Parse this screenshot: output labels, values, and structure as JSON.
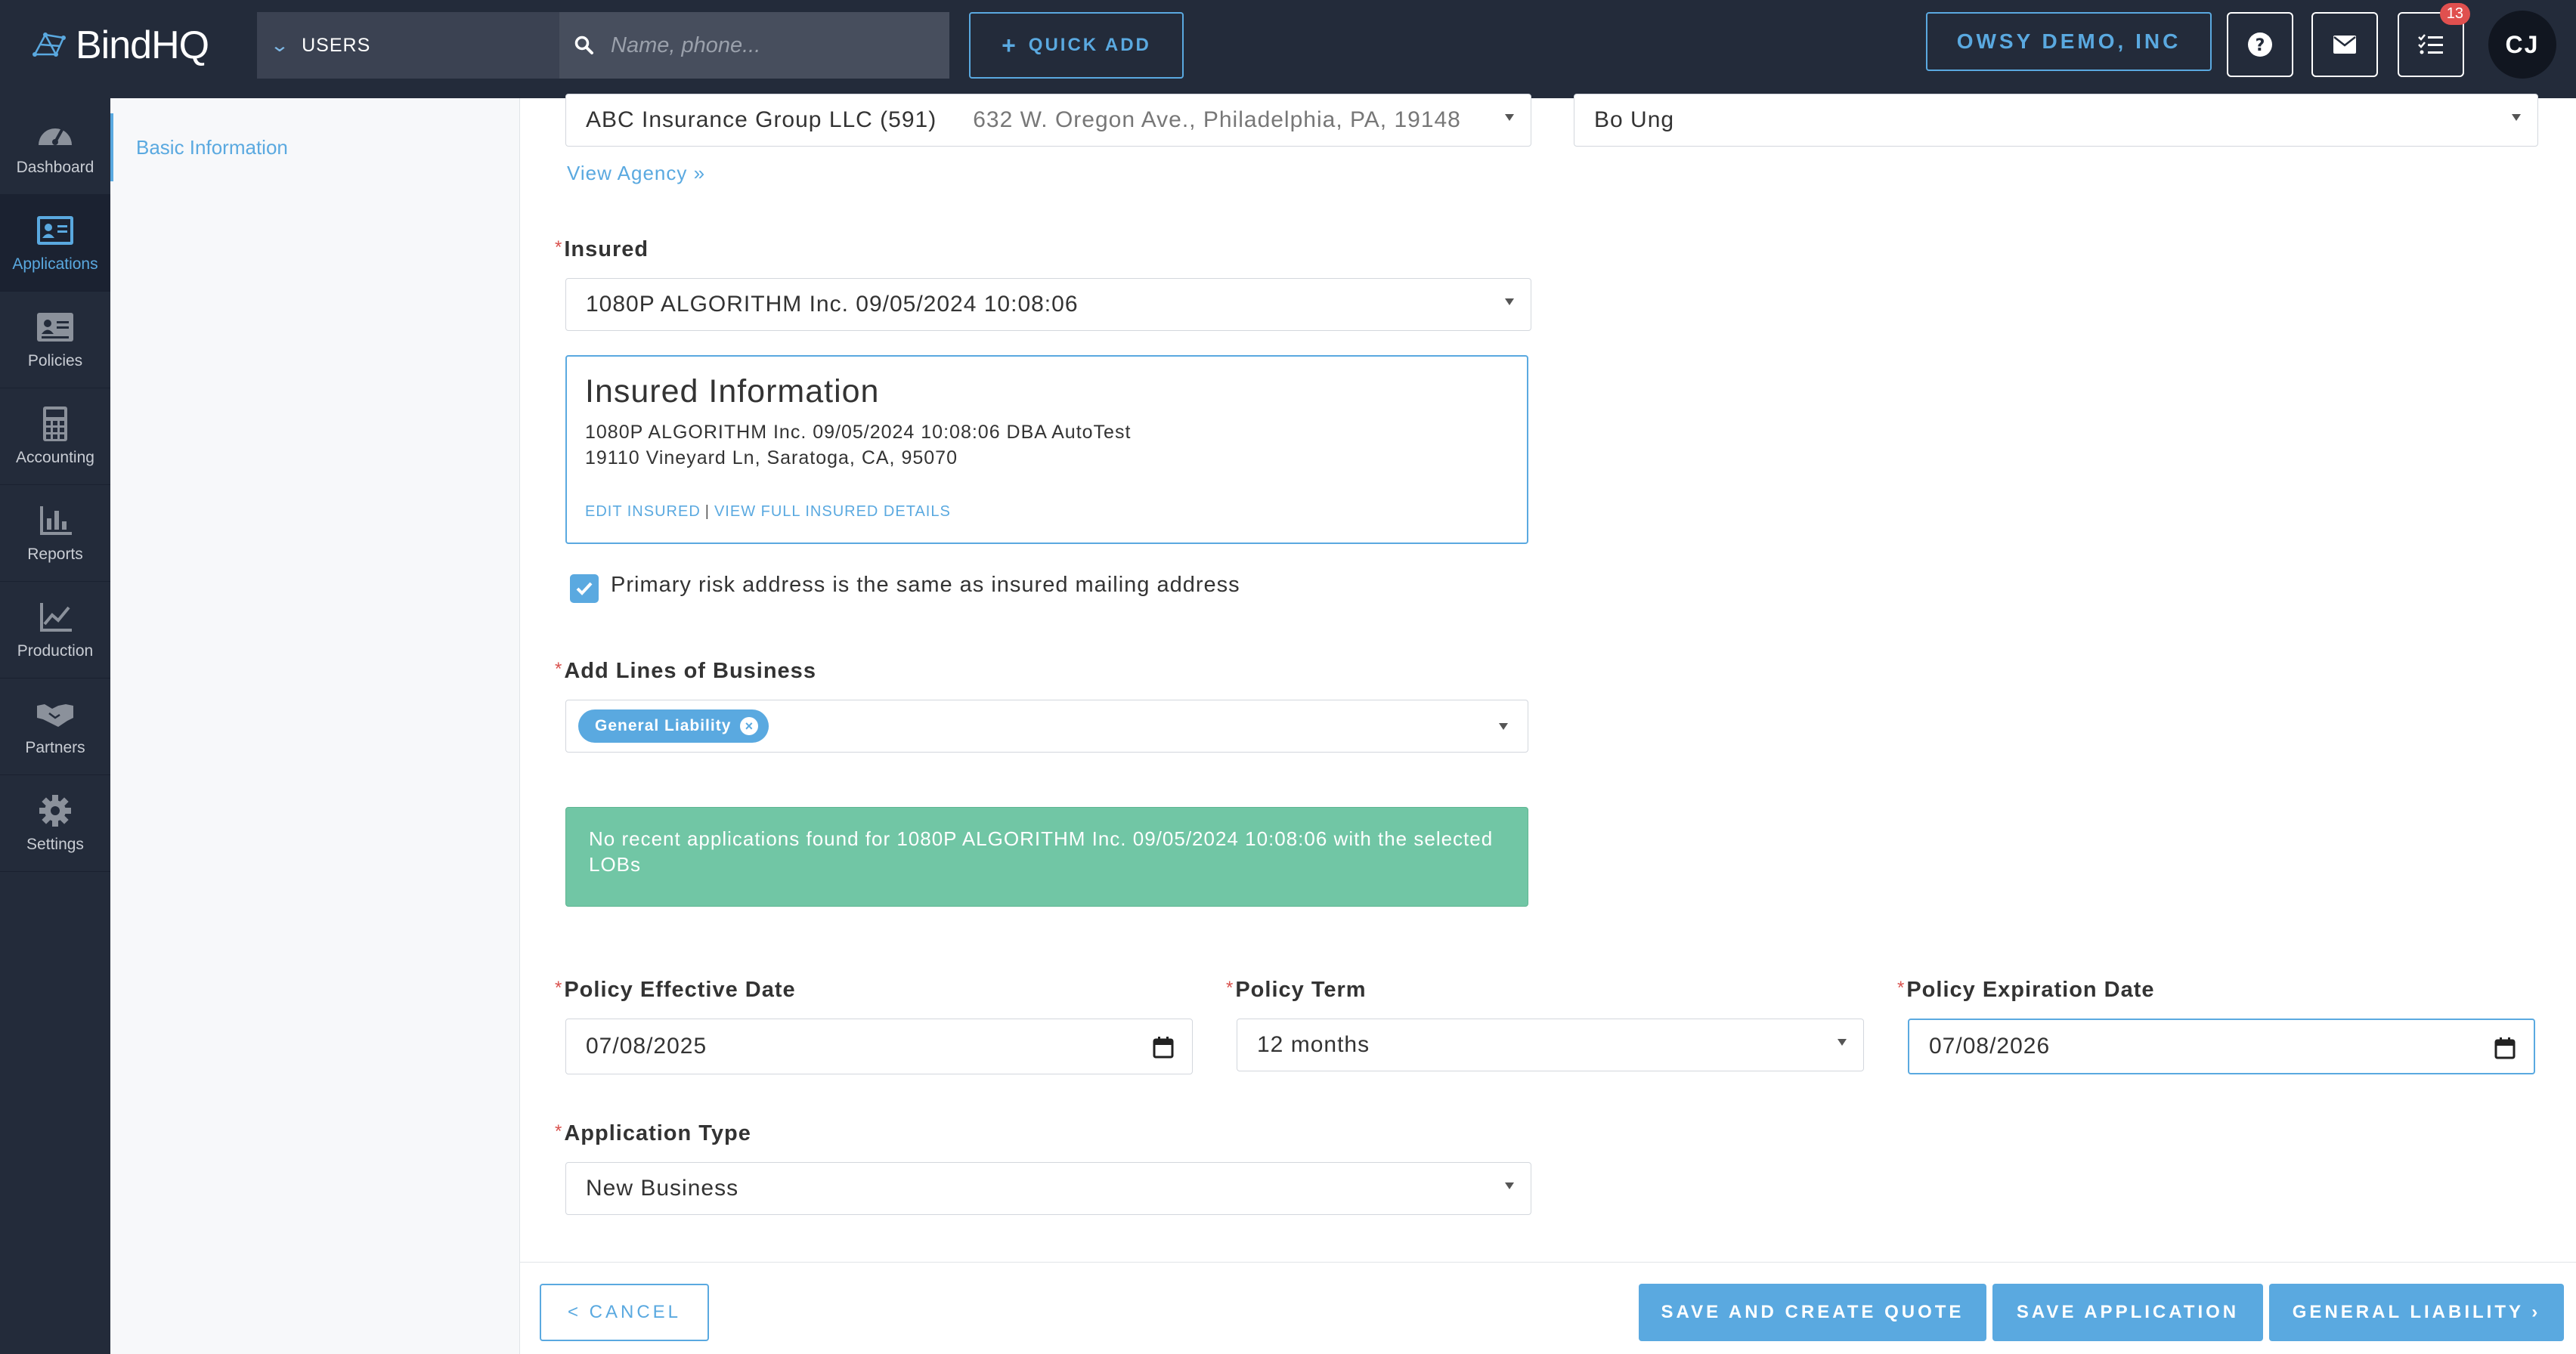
{
  "header": {
    "logo_text": "BindHQ",
    "search_scope": "USERS",
    "search_placeholder": "Name, phone...",
    "quick_add_label": "QUICK ADD",
    "org_name": "OWSY DEMO, INC",
    "tasks_badge": "13",
    "avatar_initials": "CJ"
  },
  "sidebar": {
    "items": [
      {
        "label": "Dashboard",
        "icon": "gauge-icon"
      },
      {
        "label": "Applications",
        "icon": "id-card-icon"
      },
      {
        "label": "Policies",
        "icon": "policy-card-icon"
      },
      {
        "label": "Accounting",
        "icon": "calculator-icon"
      },
      {
        "label": "Reports",
        "icon": "bar-chart-icon"
      },
      {
        "label": "Production",
        "icon": "line-chart-icon"
      },
      {
        "label": "Partners",
        "icon": "handshake-icon"
      },
      {
        "label": "Settings",
        "icon": "gear-icon"
      }
    ],
    "active": "Applications"
  },
  "subnav": {
    "items": [
      "Basic Information"
    ]
  },
  "form": {
    "agency": {
      "value": "ABC Insurance Group LLC (591)",
      "address": "632 W. Oregon Ave., Philadelphia, PA, 19148",
      "view_link": "View Agency »"
    },
    "agent": {
      "value": "Bo Ung"
    },
    "insured": {
      "label": "Insured",
      "value": "1080P ALGORITHM Inc. 09/05/2024 10:08:06"
    },
    "insured_info": {
      "title": "Insured Information",
      "name_line": "1080P ALGORITHM Inc. 09/05/2024 10:08:06 DBA AutoTest",
      "address_line": "19110 Vineyard Ln, Saratoga, CA, 95070",
      "edit_link": "EDIT INSURED",
      "separator": "|",
      "view_link": "VIEW FULL INSURED DETAILS"
    },
    "primary_risk": {
      "label": "Primary risk address is the same as insured mailing address",
      "checked": true
    },
    "lines_of_business": {
      "label": "Add Lines of Business",
      "tags": [
        "General Liability"
      ]
    },
    "alert_text": "No recent applications found for 1080P ALGORITHM Inc. 09/05/2024 10:08:06 with the selected LOBs",
    "effective_date": {
      "label": "Policy Effective Date",
      "value": "07/08/2025"
    },
    "policy_term": {
      "label": "Policy Term",
      "value": "12 months"
    },
    "expiration_date": {
      "label": "Policy Expiration Date",
      "value": "07/08/2026"
    },
    "application_type": {
      "label": "Application Type",
      "value": "New Business"
    },
    "required_marker": "*"
  },
  "footer": {
    "cancel_label": "< CANCEL",
    "save_quote_label": "SAVE AND CREATE QUOTE",
    "save_app_label": "SAVE APPLICATION",
    "next_label": "GENERAL LIABILITY ›"
  },
  "colors": {
    "accent": "#5aa9e0",
    "nav_bg": "#232b3a",
    "alert_bg": "#71c6a5",
    "required": "#d9534f"
  }
}
